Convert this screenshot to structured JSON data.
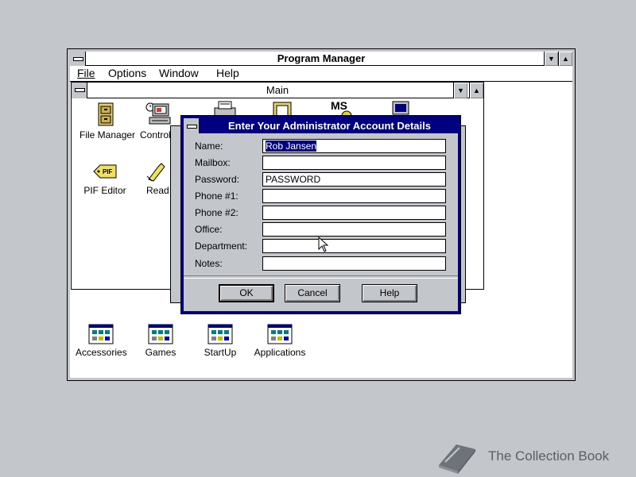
{
  "program_manager": {
    "title": "Program Manager",
    "menu": [
      "File",
      "Options",
      "Window",
      "Help"
    ],
    "min_glyph": "▼",
    "max_glyph": "▲"
  },
  "main_group": {
    "title": "Main",
    "icons": [
      {
        "label": "File Manager",
        "icon": "file-cabinet-icon"
      },
      {
        "label": "Control P",
        "icon": "control-panel-icon"
      },
      {
        "label": "PIF Editor",
        "icon": "pif-editor-icon"
      },
      {
        "label": "Read M",
        "icon": "read-me-icon"
      }
    ]
  },
  "group_icons": [
    {
      "label": "Accessories"
    },
    {
      "label": "Games"
    },
    {
      "label": "StartUp"
    },
    {
      "label": "Applications"
    }
  ],
  "dialog": {
    "title": "Enter Your Administrator Account Details",
    "fields": [
      {
        "label": "Name:",
        "value": "Rob Jansen"
      },
      {
        "label": "Mailbox:",
        "value": ""
      },
      {
        "label": "Password:",
        "value": "PASSWORD"
      },
      {
        "label": "Phone #1:",
        "value": ""
      },
      {
        "label": "Phone #2:",
        "value": ""
      },
      {
        "label": "Office:",
        "value": ""
      },
      {
        "label": "Department:",
        "value": ""
      },
      {
        "label": "Notes:",
        "value": ""
      }
    ],
    "buttons": {
      "ok": "OK",
      "cancel": "Cancel",
      "help": "Help"
    }
  },
  "watermark": {
    "text": "The Collection Book"
  },
  "colors": {
    "desktop": "#c3c7cb",
    "title_active": "#000080",
    "selection": "#000080"
  }
}
